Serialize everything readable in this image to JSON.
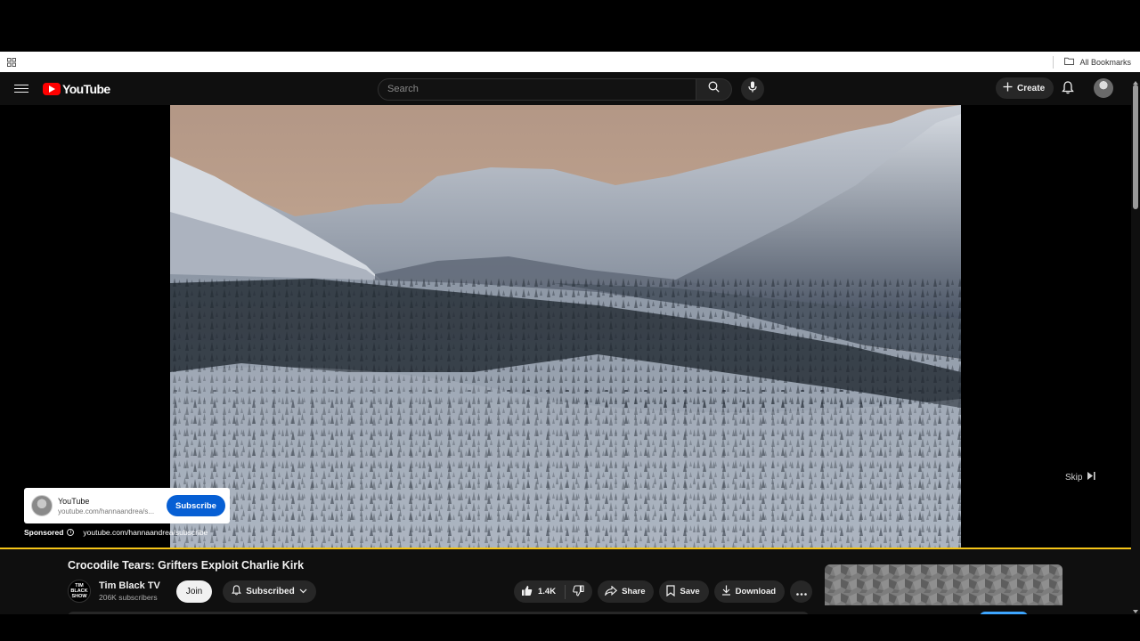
{
  "browser": {
    "bookmarks_label": "All Bookmarks"
  },
  "masthead": {
    "logo_text": "YouTube",
    "search_placeholder": "Search",
    "create_label": "Create"
  },
  "player": {
    "skip_label": "Skip",
    "ad": {
      "channel": "YouTube",
      "url": "youtube.com/hannaandrea/s...",
      "subscribe_label": "Subscribe",
      "sponsored_label": "Sponsored",
      "sponsored_link": "youtube.com/hannaandrea/subscribe"
    },
    "progress_color": "#f5c518"
  },
  "video": {
    "title": "Crocodile Tears: Grifters Exploit Charlie Kirk",
    "channel_avatar_lines": [
      "TIM",
      "BLACK",
      "SHOW"
    ],
    "channel_name": "Tim Black TV",
    "subscribers": "206K subscribers",
    "join_label": "Join",
    "subscribed_label": "Subscribed",
    "likes": "1.4K",
    "share_label": "Share",
    "save_label": "Save",
    "download_label": "Download"
  },
  "colors": {
    "brand_red": "#ff0000",
    "subscribe_blue": "#065fd4",
    "bg_dark": "#0f0f0f",
    "pill_bg": "#272727"
  }
}
